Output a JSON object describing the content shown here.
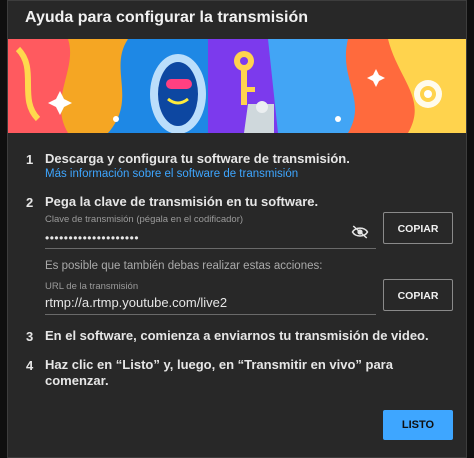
{
  "dialog": {
    "title": "Ayuda para configurar la transmisión"
  },
  "steps": [
    {
      "number": "1",
      "text": "Descarga y configura tu software de transmisión.",
      "link": "Más información sobre el software de transmisión"
    },
    {
      "number": "2",
      "text": "Pega la clave de transmisión en tu software.",
      "key_label": "Clave de transmisión (pégala en el codificador)",
      "key_value": "••••••••••••••••••••",
      "copy_label": "COPIAR",
      "hint": "Es posible que también debas realizar estas acciones:",
      "url_label": "URL de la transmisión",
      "url_value": "rtmp://a.rtmp.youtube.com/live2",
      "url_copy_label": "COPIAR"
    },
    {
      "number": "3",
      "text": "En el software, comienza a enviarnos tu transmisión de video."
    },
    {
      "number": "4",
      "text_line1": "Haz clic en “Listo” y, luego, en “Transmitir en vivo” para",
      "text_line2": "comenzar."
    }
  ],
  "done_label": "LISTO",
  "icons": {
    "visibility": "eye-off-icon"
  },
  "colors": {
    "accent": "#3ea6ff",
    "dialog_bg": "#282828"
  }
}
